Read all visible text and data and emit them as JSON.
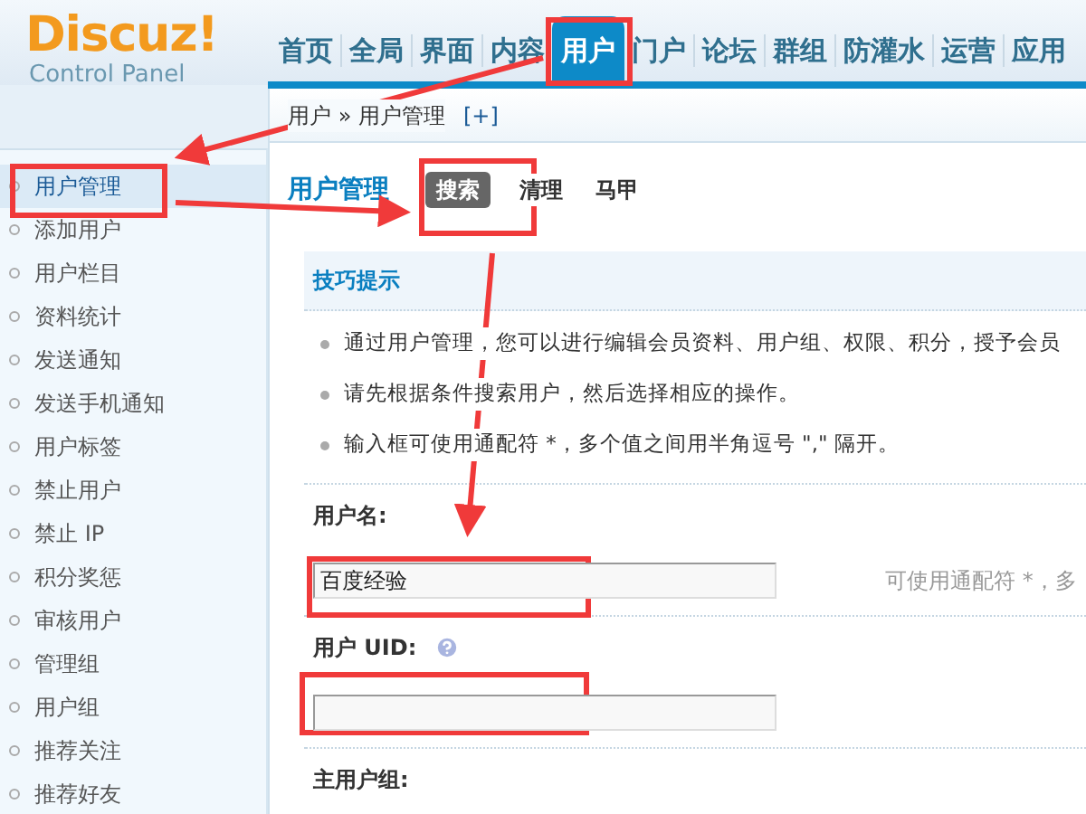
{
  "logo": {
    "title": "Discuz!",
    "subtitle": "Control Panel"
  },
  "nav": [
    {
      "label": "首页",
      "selected": false
    },
    {
      "label": "全局",
      "selected": false
    },
    {
      "label": "界面",
      "selected": false
    },
    {
      "label": "内容",
      "selected": false
    },
    {
      "label": "用户",
      "selected": true
    },
    {
      "label": "门户",
      "selected": false
    },
    {
      "label": "论坛",
      "selected": false
    },
    {
      "label": "群组",
      "selected": false
    },
    {
      "label": "防灌水",
      "selected": false
    },
    {
      "label": "运营",
      "selected": false
    },
    {
      "label": "应用",
      "selected": false
    }
  ],
  "breadcrumb": {
    "path": "用户 » 用户管理",
    "action": "[+]"
  },
  "sidebar": {
    "items": [
      {
        "label": "用户管理",
        "selected": true
      },
      {
        "label": "添加用户",
        "selected": false
      },
      {
        "label": "用户栏目",
        "selected": false
      },
      {
        "label": "资料统计",
        "selected": false
      },
      {
        "label": "发送通知",
        "selected": false
      },
      {
        "label": "发送手机通知",
        "selected": false
      },
      {
        "label": "用户标签",
        "selected": false
      },
      {
        "label": "禁止用户",
        "selected": false
      },
      {
        "label": "禁止 IP",
        "selected": false
      },
      {
        "label": "积分奖惩",
        "selected": false
      },
      {
        "label": "审核用户",
        "selected": false
      },
      {
        "label": "管理组",
        "selected": false
      },
      {
        "label": "用户组",
        "selected": false
      },
      {
        "label": "推荐关注",
        "selected": false
      },
      {
        "label": "推荐好友",
        "selected": false
      }
    ]
  },
  "page": {
    "title": "用户管理",
    "tabs": [
      {
        "label": "搜索",
        "selected": true
      },
      {
        "label": "清理",
        "selected": false
      },
      {
        "label": "马甲",
        "selected": false
      }
    ]
  },
  "tips": {
    "title": "技巧提示",
    "items": [
      "通过用户管理，您可以进行编辑会员资料、用户组、权限、积分，授予会员",
      "请先根据条件搜索用户，然后选择相应的操作。",
      "输入框可使用通配符 *，多个值之间用半角逗号 \",\" 隔开。"
    ]
  },
  "form": {
    "fields": [
      {
        "kind": "input",
        "label": "用户名:",
        "value": "百度经验",
        "note": "可使用通配符 *，多",
        "help": false
      },
      {
        "kind": "input",
        "label": "用户 UID:",
        "help": true
      },
      {
        "kind": "heading",
        "label": "主用户组:",
        "help": false
      }
    ]
  }
}
